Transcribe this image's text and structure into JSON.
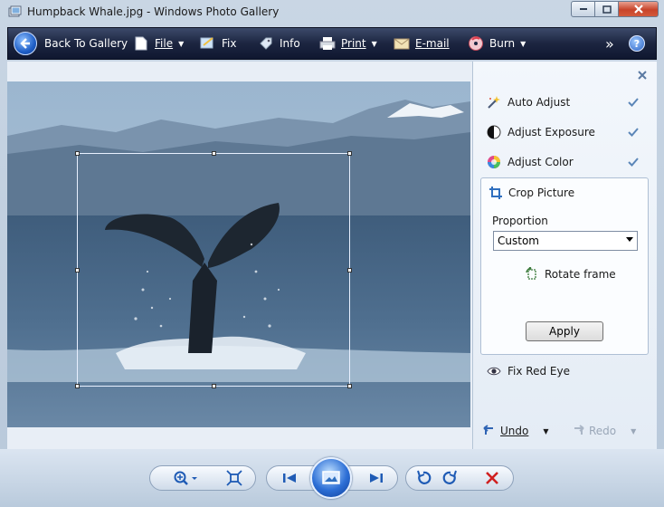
{
  "window": {
    "title": "Humpback Whale.jpg - Windows Photo Gallery"
  },
  "toolbar": {
    "back_label": "Back To Gallery",
    "file_label": "File",
    "fix_label": "Fix",
    "info_label": "Info",
    "print_label": "Print",
    "email_label": "E-mail",
    "burn_label": "Burn",
    "more_label": "»",
    "help_label": "?"
  },
  "fix_panel": {
    "auto_adjust": "Auto Adjust",
    "adjust_exposure": "Adjust Exposure",
    "adjust_color": "Adjust Color",
    "crop_picture": "Crop Picture",
    "proportion_label": "Proportion",
    "proportion_value": "Custom",
    "rotate_frame": "Rotate frame",
    "apply_label": "Apply",
    "fix_red_eye": "Fix Red Eye",
    "undo_label": "Undo",
    "redo_label": "Redo"
  },
  "colors": {
    "toolbar_bg": "#1c2540",
    "accent_blue": "#2d6fd6",
    "delete_red": "#d02020"
  },
  "icons": {
    "app": "photo-gallery-icon",
    "zoom": "zoom-icon",
    "actual_size": "actual-size-icon",
    "previous": "previous-icon",
    "slideshow": "slideshow-icon",
    "next": "next-icon",
    "rotate_ccw": "rotate-counterclockwise-icon",
    "rotate_cw": "rotate-clockwise-icon",
    "delete": "delete-icon"
  }
}
